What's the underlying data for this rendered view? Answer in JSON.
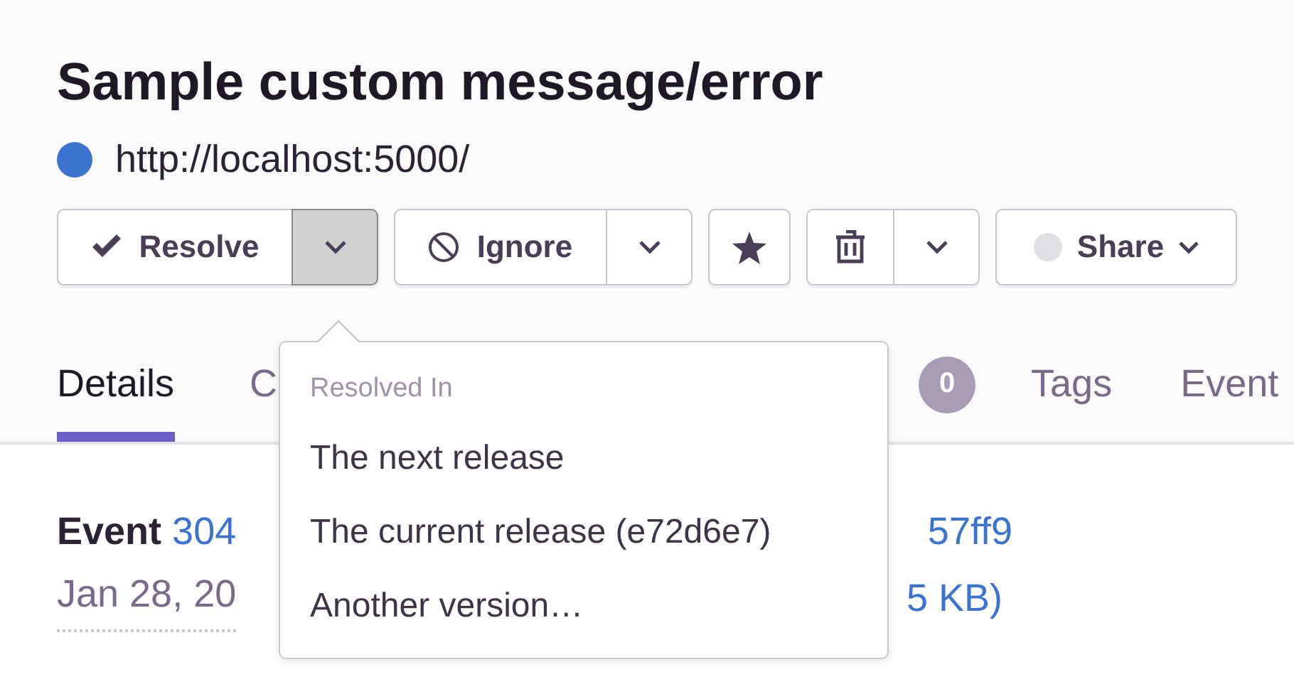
{
  "title": "Sample custom message/error",
  "url": {
    "text": "http://localhost:5000/",
    "color": "#3b73d1"
  },
  "toolbar": [
    {
      "kind": "resolve",
      "label": "Resolve",
      "caret": true,
      "caret_pressed": true
    },
    {
      "kind": "ignore",
      "label": "Ignore",
      "caret": true,
      "caret_pressed": false
    },
    {
      "kind": "bookmark",
      "caret": false
    },
    {
      "kind": "delete",
      "caret": true,
      "caret_pressed": false
    },
    {
      "kind": "share",
      "label": "Share",
      "caret": false
    }
  ],
  "tabs": [
    {
      "label": "Details",
      "selected": true
    },
    {
      "label": "C",
      "selected": false
    },
    {
      "selected": false,
      "badge": "0"
    },
    {
      "label": "Tags",
      "selected": false
    },
    {
      "label": "Event",
      "selected": false
    }
  ],
  "event": {
    "label": "Event",
    "id": "304",
    "id_tail": "57ff9",
    "date": "Jan 28, 20",
    "size_tail": "5 KB)"
  },
  "dropdown": {
    "header": "Resolved In",
    "items": [
      "The next release",
      "The current release (e72d6e7)",
      "Another version…"
    ]
  }
}
